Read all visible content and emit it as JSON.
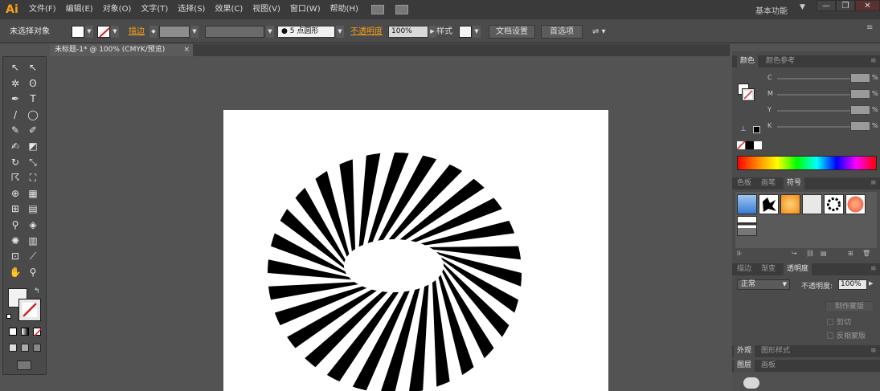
{
  "app": {
    "logo": "Ai"
  },
  "menu": [
    "文件(F)",
    "编辑(E)",
    "对象(O)",
    "文字(T)",
    "选择(S)",
    "效果(C)",
    "视图(V)",
    "窗口(W)",
    "帮助(H)"
  ],
  "workspace": {
    "label": "基本功能"
  },
  "window_controls": {
    "minimize": "—",
    "restore": "❐",
    "close": "✕"
  },
  "control_bar": {
    "selection_status": "未选择对象",
    "stroke_label": "描边",
    "brush_value": "5 点圆形",
    "opacity_label": "不透明度",
    "opacity_value": "100%",
    "style_label": "样式",
    "doc_settings_button": "文档设置",
    "preferences_button": "首选项"
  },
  "document_tab": {
    "title": "未标题-1* @ 100% (CMYK/预览)",
    "close": "×"
  },
  "tools": [
    {
      "name": "selection-tool-icon",
      "glyph": "↖"
    },
    {
      "name": "direct-selection-tool-icon",
      "glyph": "↖"
    },
    {
      "name": "magic-wand-tool-icon",
      "glyph": "✲"
    },
    {
      "name": "lasso-tool-icon",
      "glyph": "ʘ"
    },
    {
      "name": "pen-tool-icon",
      "glyph": "✒"
    },
    {
      "name": "type-tool-icon",
      "glyph": "T"
    },
    {
      "name": "line-tool-icon",
      "glyph": "/"
    },
    {
      "name": "ellipse-tool-icon",
      "glyph": "◯"
    },
    {
      "name": "paintbrush-tool-icon",
      "glyph": "✎"
    },
    {
      "name": "pencil-tool-icon",
      "glyph": "✐"
    },
    {
      "name": "blob-brush-tool-icon",
      "glyph": "✍"
    },
    {
      "name": "eraser-tool-icon",
      "glyph": "◩"
    },
    {
      "name": "rotate-tool-icon",
      "glyph": "↻"
    },
    {
      "name": "scale-tool-icon",
      "glyph": "⤡"
    },
    {
      "name": "warp-tool-icon",
      "glyph": "☈"
    },
    {
      "name": "free-transform-tool-icon",
      "glyph": "⛶"
    },
    {
      "name": "shape-builder-tool-icon",
      "glyph": "⊕"
    },
    {
      "name": "perspective-grid-tool-icon",
      "glyph": "▦"
    },
    {
      "name": "mesh-tool-icon",
      "glyph": "⊞"
    },
    {
      "name": "gradient-tool-icon",
      "glyph": "▤"
    },
    {
      "name": "eyedropper-tool-icon",
      "glyph": "⚲"
    },
    {
      "name": "blend-tool-icon",
      "glyph": "◈"
    },
    {
      "name": "symbol-sprayer-tool-icon",
      "glyph": "✺"
    },
    {
      "name": "column-graph-tool-icon",
      "glyph": "▥"
    },
    {
      "name": "artboard-tool-icon",
      "glyph": "⊡"
    },
    {
      "name": "slice-tool-icon",
      "glyph": "⟋"
    },
    {
      "name": "hand-tool-icon",
      "glyph": "✋"
    },
    {
      "name": "zoom-tool-icon",
      "glyph": "⚲"
    }
  ],
  "color_panel": {
    "tabs": [
      "颜色",
      "颜色参考"
    ],
    "channels": [
      "C",
      "M",
      "Y",
      "K"
    ],
    "percent": "%"
  },
  "symbols_panel": {
    "tabs": [
      "色板",
      "画笔",
      "符号"
    ]
  },
  "transparency_panel": {
    "tabs": [
      "描边",
      "渐变",
      "透明度"
    ],
    "blend_mode": "正常",
    "opacity_label": "不透明度:",
    "opacity_value": "100%",
    "make_mask_button": "制作蒙版",
    "clip_label": "剪切",
    "invert_mask_label": "反相蒙版"
  },
  "appearance_panel": {
    "tabs": [
      "外观",
      "图形样式"
    ]
  },
  "layers_panel": {
    "tabs": [
      "图层",
      "画板"
    ]
  },
  "colors": {
    "accent_orange": "#f7a01c",
    "none_red": "#d92020",
    "canvas": "#535353",
    "artboard": "#ffffff",
    "stripe_black": "#000000"
  }
}
